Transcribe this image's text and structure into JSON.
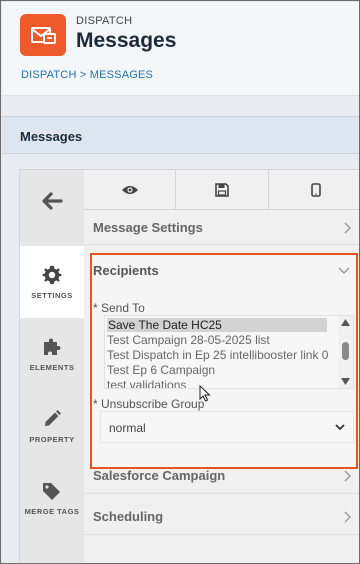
{
  "header": {
    "app_label": "DISPATCH",
    "title": "Messages",
    "breadcrumb": [
      "DISPATCH",
      "MESSAGES"
    ],
    "breadcrumb_sep": ">",
    "brand_color": "#ee5a2b"
  },
  "section": {
    "title": "Messages"
  },
  "rail": {
    "items": [
      {
        "label": "SETTINGS",
        "icon": "gear-icon",
        "active": true
      },
      {
        "label": "ELEMENTS",
        "icon": "puzzle-icon"
      },
      {
        "label": "PROPERTY",
        "icon": "pencil-icon"
      },
      {
        "label": "MERGE TAGS",
        "icon": "tag-icon"
      }
    ]
  },
  "toolbar": {
    "buttons": [
      "eye-icon",
      "save-icon",
      "mobile-icon"
    ]
  },
  "accordion": {
    "message_settings": "Message Settings",
    "recipients": "Recipients",
    "salesforce_campaign": "Salesforce Campaign",
    "scheduling": "Scheduling"
  },
  "recipients": {
    "send_to_label": "* Send To",
    "send_to_options": [
      "Save The Date HC25",
      "Test Campaign 28-05-2025 list",
      "Test Dispatch in Ep 25 intellibooster link 0",
      "Test Ep 6 Campaign",
      "test validations"
    ],
    "send_to_selected": "Save The Date HC25",
    "unsubscribe_label": "* Unsubscribe Group",
    "unsubscribe_value": "normal"
  },
  "colors": {
    "highlight_border": "#e8541e",
    "link": "#1f73b7"
  }
}
